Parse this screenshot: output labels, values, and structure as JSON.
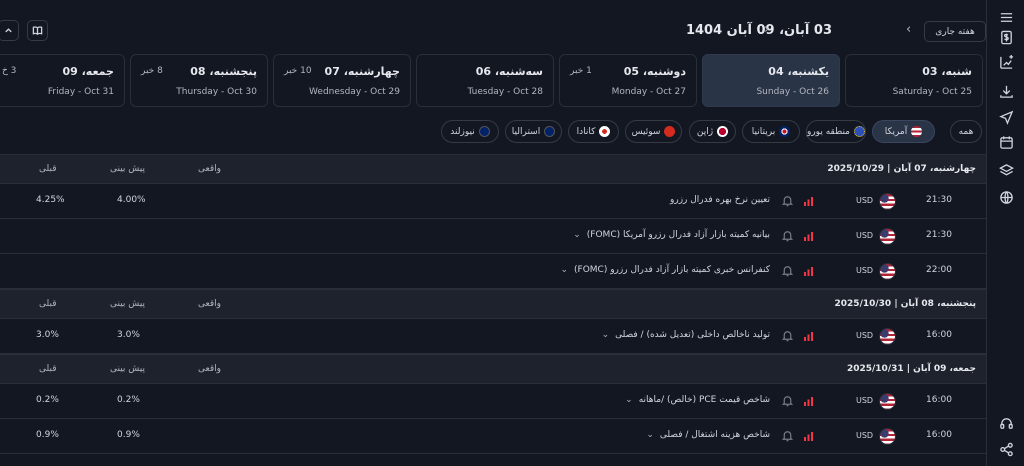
{
  "header": {
    "title": "03 آبان، 09 آبان 1404",
    "prev": "‹",
    "next": "›",
    "current_week_label": "هفته جاری"
  },
  "days": [
    {
      "name": "شنبه، 03",
      "count": "",
      "date": "Saturday - Oct 25"
    },
    {
      "name": "یکشنبه، 04",
      "count": "",
      "date": "Sunday - Oct 26"
    },
    {
      "name": "دوشنبه، 05",
      "count": "1 خبر",
      "date": "Monday - Oct 27"
    },
    {
      "name": "سه‌شنبه، 06",
      "count": "",
      "date": "Tuesday - Oct 28"
    },
    {
      "name": "چهارشنبه، 07",
      "count": "10 خبر",
      "date": "Wednesday - Oct 29"
    },
    {
      "name": "پنجشنبه، 08",
      "count": "8 خبر",
      "date": "Thursday - Oct 30"
    },
    {
      "name": "جمعه، 09",
      "count": "3 خ",
      "date": "Friday - Oct 31"
    }
  ],
  "filters": [
    {
      "label": "همه"
    },
    {
      "label": "آمریکا"
    },
    {
      "label": "منطقه یورو"
    },
    {
      "label": "بریتانیا"
    },
    {
      "label": "ژاپن"
    },
    {
      "label": "سوئیس"
    },
    {
      "label": "کانادا"
    },
    {
      "label": "استرالیا"
    },
    {
      "label": "نیوزلند"
    }
  ],
  "columns": {
    "actual": "واقعی",
    "forecast": "پیش بینی",
    "previous": "قبلی"
  },
  "sections": [
    {
      "date": "چهارشنبه، 07 آبان | 2025/10/29",
      "rows": [
        {
          "time": "21:30",
          "currency": "USD",
          "event": "تعیین نرخ بهره فدرال رزرو",
          "expand": "",
          "forecast": "4.00%",
          "previous": "4.25%"
        },
        {
          "time": "21:30",
          "currency": "USD",
          "event": "بیانیه کمیته بازار آزاد فدرال رزرو آمریکا (FOMC)",
          "expand": "⌄",
          "forecast": "",
          "previous": ""
        },
        {
          "time": "22:00",
          "currency": "USD",
          "event": "کنفرانس خبری کمیته بازار آزاد فدرال رزرو (FOMC)",
          "expand": "⌄",
          "forecast": "",
          "previous": ""
        }
      ]
    },
    {
      "date": "پنجشنبه، 08 آبان | 2025/10/30",
      "rows": [
        {
          "time": "16:00",
          "currency": "USD",
          "event": "تولید ناخالص داخلی (تعدیل شده) / فصلی",
          "expand": "⌄",
          "forecast": "3.0%",
          "previous": "3.0%"
        }
      ]
    },
    {
      "date": "جمعه، 09 آبان | 2025/10/31",
      "rows": [
        {
          "time": "16:00",
          "currency": "USD",
          "event": "شاخص قیمت PCE (خالص) /ماهانه",
          "expand": "⌄",
          "forecast": "0.2%",
          "previous": "0.2%"
        },
        {
          "time": "16:00",
          "currency": "USD",
          "event": "شاخص هزینه اشتغال / فصلی",
          "expand": "⌄",
          "forecast": "0.9%",
          "previous": "0.9%"
        }
      ]
    }
  ],
  "colors": {
    "importance_high": "#f23645",
    "accent": "#2962ff",
    "bg": "#131722"
  }
}
